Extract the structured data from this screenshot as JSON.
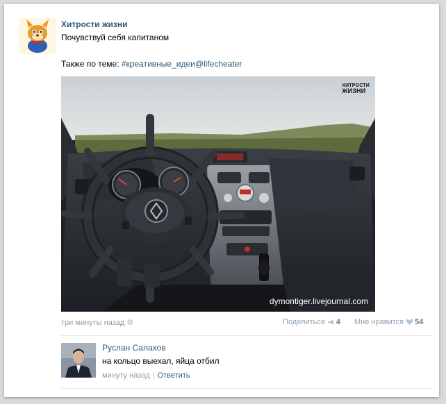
{
  "post": {
    "author": "Хитрости жизни",
    "text": "Почувствуй себя капитаном",
    "related_prefix": "Также по теме: ",
    "related_link": "#креативные_идеи@lifecheater",
    "watermark_line1": "ХИТРОСТИ",
    "watermark_line2": "ЖИЗНИ",
    "watermark_url": "dymontiger.livejournal.com",
    "time": "три минуты назад",
    "share_label": "Поделиться",
    "share_count": "4",
    "like_label": "Мне нравится",
    "like_count": "54"
  },
  "comment": {
    "author": "Руслан Салахов",
    "text": "на кольцо выехал, яйца отбил",
    "time": "минуту назад",
    "separator": "|",
    "reply_label": "Ответить"
  },
  "colors": {
    "link": "#2b587a",
    "muted": "#999999",
    "like": "#8fa1b3"
  }
}
